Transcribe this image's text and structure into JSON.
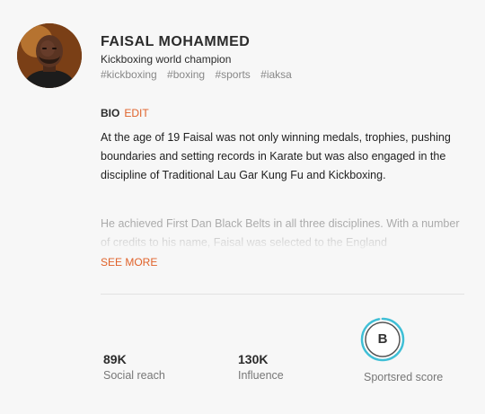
{
  "profile": {
    "name": "FAISAL MOHAMMED",
    "tagline": "Kickboxing world champion",
    "tags": [
      "#kickboxing",
      "#boxing",
      "#sports",
      "#iaksa"
    ]
  },
  "bio": {
    "label": "BIO",
    "edit_label": "EDIT",
    "paragraph1": "At the age of 19 Faisal was not only winning medals, trophies, pushing boundaries and setting records in Karate but was also engaged in the discipline of Traditional Lau Gar Kung Fu and Kickboxing.",
    "paragraph2": "He achieved First Dan Black Belts in all three disciplines. With a number of credits to his name, Faisal was selected to the England",
    "see_more_label": "SEE MORE"
  },
  "stats": {
    "social_reach": {
      "value": "89K",
      "label": "Social reach"
    },
    "influence": {
      "value": "130K",
      "label": "Influence"
    },
    "score": {
      "grade": "B",
      "label": "Sportsred score",
      "ring_color": "#3fbfd6",
      "progress": 0.97
    }
  },
  "colors": {
    "accent": "#e0622a",
    "ring": "#3fbfd6"
  }
}
